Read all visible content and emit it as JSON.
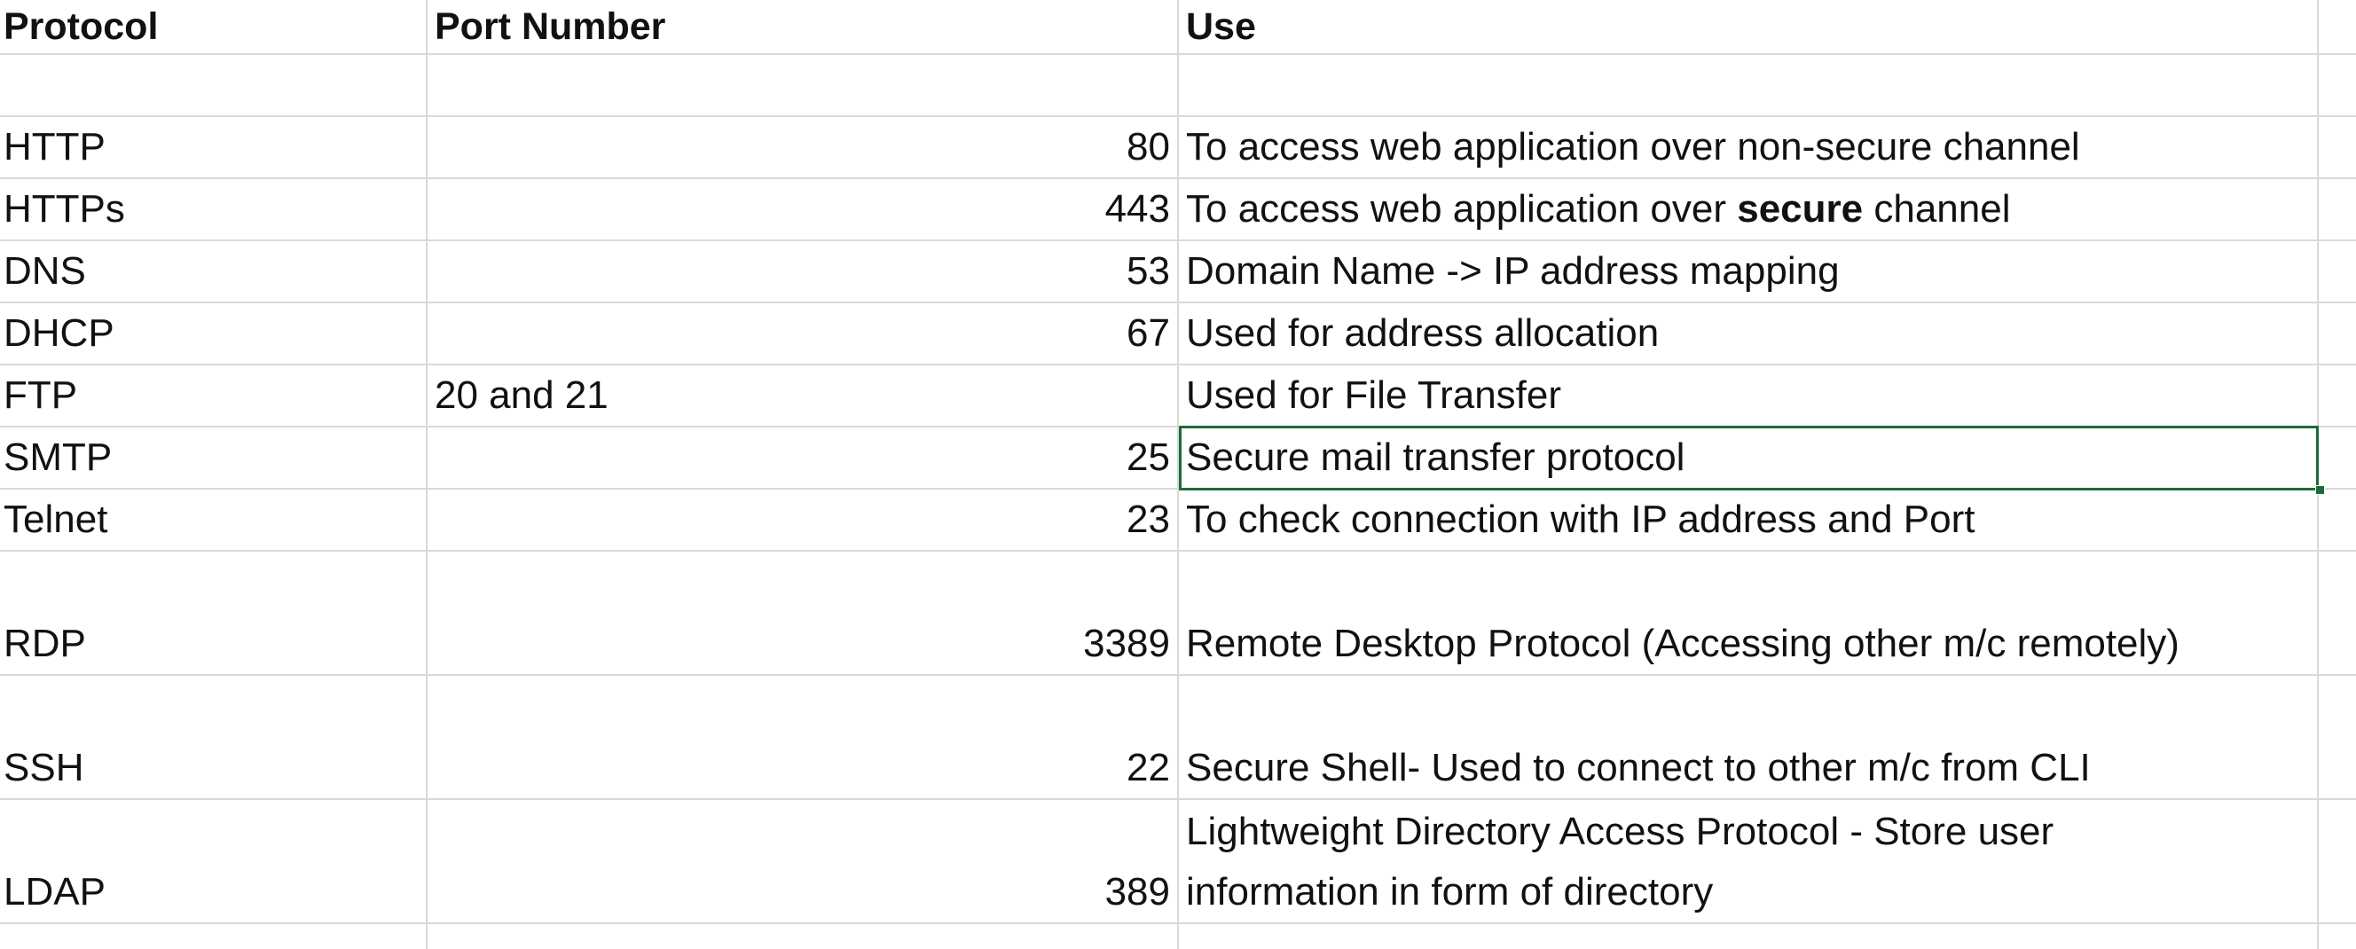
{
  "headers": {
    "protocol": "Protocol",
    "port": "Port Number",
    "use": "Use"
  },
  "rows": [
    {
      "protocol": "HTTP",
      "port": "80",
      "use_pre": "To access web application over non-secure channel",
      "use_bold": "",
      "use_post": ""
    },
    {
      "protocol": "HTTPs",
      "port": "443",
      "use_pre": "To access web application over ",
      "use_bold": "secure",
      "use_post": " channel"
    },
    {
      "protocol": "DNS",
      "port": "53",
      "use_pre": "Domain Name -> IP address mapping",
      "use_bold": "",
      "use_post": ""
    },
    {
      "protocol": "DHCP",
      "port": "67",
      "use_pre": "Used for address allocation",
      "use_bold": "",
      "use_post": ""
    },
    {
      "protocol": "FTP",
      "port_text": "20 and 21",
      "use_pre": "Used for File Transfer",
      "use_bold": "",
      "use_post": ""
    },
    {
      "protocol": "SMTP",
      "port": "25",
      "use_pre": "Secure mail transfer protocol",
      "use_bold": "",
      "use_post": ""
    },
    {
      "protocol": "Telnet",
      "port": "23",
      "use_pre": "To check connection with IP address and Port",
      "use_bold": "",
      "use_post": ""
    },
    {
      "protocol": "RDP",
      "port": "3389",
      "use_pre": "Remote Desktop Protocol (Accessing other m/c remotely)",
      "use_bold": "",
      "use_post": ""
    },
    {
      "protocol": "SSH",
      "port": "22",
      "use_pre": "Secure Shell- Used to connect to other m/c from CLI",
      "use_bold": "",
      "use_post": ""
    },
    {
      "protocol": "LDAP",
      "port": "389",
      "use_line1": "Lightweight Directory Access Protocol - Store user",
      "use_line2": "information in form of directory"
    }
  ],
  "selected_cell": "C8",
  "colors": {
    "gridline": "#d9d9d9",
    "selection": "#1e6b3a"
  }
}
